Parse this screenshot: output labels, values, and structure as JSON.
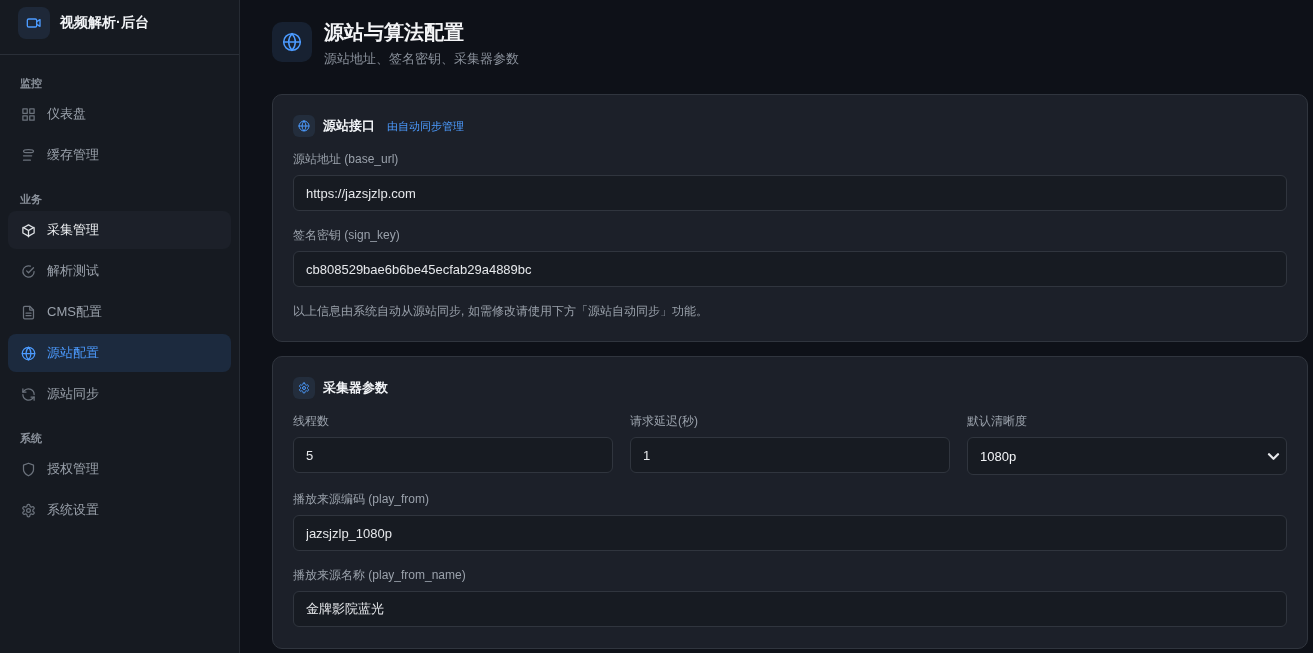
{
  "sidebar": {
    "brand": "视频解析·后台",
    "sections": [
      {
        "label": "监控",
        "items": [
          {
            "label": "仪表盘",
            "selected": false,
            "hovered": false
          },
          {
            "label": "缓存管理",
            "selected": false,
            "hovered": false
          }
        ]
      },
      {
        "label": "业务",
        "items": [
          {
            "label": "采集管理",
            "selected": false,
            "hovered": true
          },
          {
            "label": "解析测试",
            "selected": false,
            "hovered": false
          },
          {
            "label": "CMS配置",
            "selected": false,
            "hovered": false
          },
          {
            "label": "源站配置",
            "selected": true,
            "hovered": false
          },
          {
            "label": "源站同步",
            "selected": false,
            "hovered": false
          }
        ]
      },
      {
        "label": "系统",
        "items": [
          {
            "label": "授权管理",
            "selected": false,
            "hovered": false
          },
          {
            "label": "系统设置",
            "selected": false,
            "hovered": false
          }
        ]
      }
    ]
  },
  "header": {
    "title": "源站与算法配置",
    "subtitle": "源站地址、签名密钥、采集器参数"
  },
  "cards": [
    {
      "title": "源站接口",
      "tag": "由自动同步管理",
      "rows": [
        [
          {
            "kind": "input",
            "label": "源站地址 (base_url)",
            "value": "https://jazsjzlp.com"
          }
        ],
        [
          {
            "kind": "input",
            "label": "签名密钥 (sign_key)",
            "value": "cb808529bae6b6be45ecfab29a4889bc"
          }
        ]
      ],
      "note": "以上信息由系统自动从源站同步, 如需修改请使用下方「源站自动同步」功能。"
    },
    {
      "title": "采集器参数",
      "rows": [
        [
          {
            "kind": "input",
            "label": "线程数",
            "value": "5"
          },
          {
            "kind": "input",
            "label": "请求延迟(秒)",
            "value": "1"
          },
          {
            "kind": "select",
            "label": "默认清晰度",
            "value": "1080p"
          }
        ],
        [
          {
            "kind": "input",
            "label": "播放来源编码 (play_from)",
            "value": "jazsjzlp_1080p"
          }
        ],
        [
          {
            "kind": "input",
            "label": "播放来源名称 (play_from_name)",
            "value": "金牌影院蓝光"
          }
        ]
      ]
    }
  ]
}
